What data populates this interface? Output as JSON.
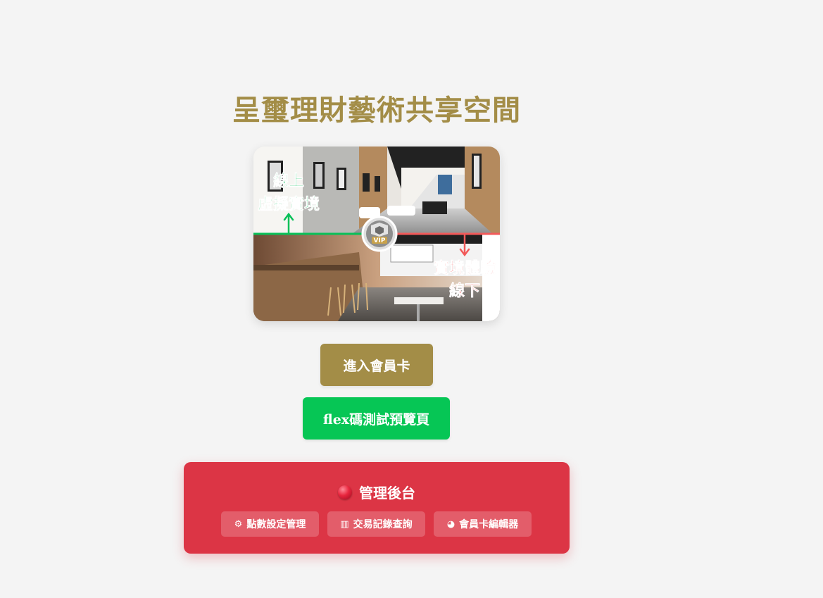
{
  "page": {
    "title": "呈璽理財藝術共享空間"
  },
  "hero": {
    "labels": {
      "online_line1": "線上",
      "online_line2": "虛擬實境",
      "offline_line1": "實境體驗",
      "offline_line2": "線下",
      "badge": "VIP"
    },
    "colors": {
      "online": "#08c058",
      "offline": "#f25a5a"
    }
  },
  "buttons": {
    "member_card": "進入會員卡",
    "flex_preview": "flex碼測試預覽頁"
  },
  "admin": {
    "title": "管理後台",
    "links": [
      {
        "icon": "gear-icon",
        "glyph": "⚙",
        "label": "點數設定管理"
      },
      {
        "icon": "bar-chart-icon",
        "glyph": "▥",
        "label": "交易記錄查詢"
      },
      {
        "icon": "palette-icon",
        "glyph": "◕",
        "label": "會員卡編輯器"
      }
    ]
  },
  "colors": {
    "brand_gold": "#a38d47",
    "line_green": "#06c655",
    "admin_red": "#dc3545",
    "background": "#f4f4f4"
  }
}
